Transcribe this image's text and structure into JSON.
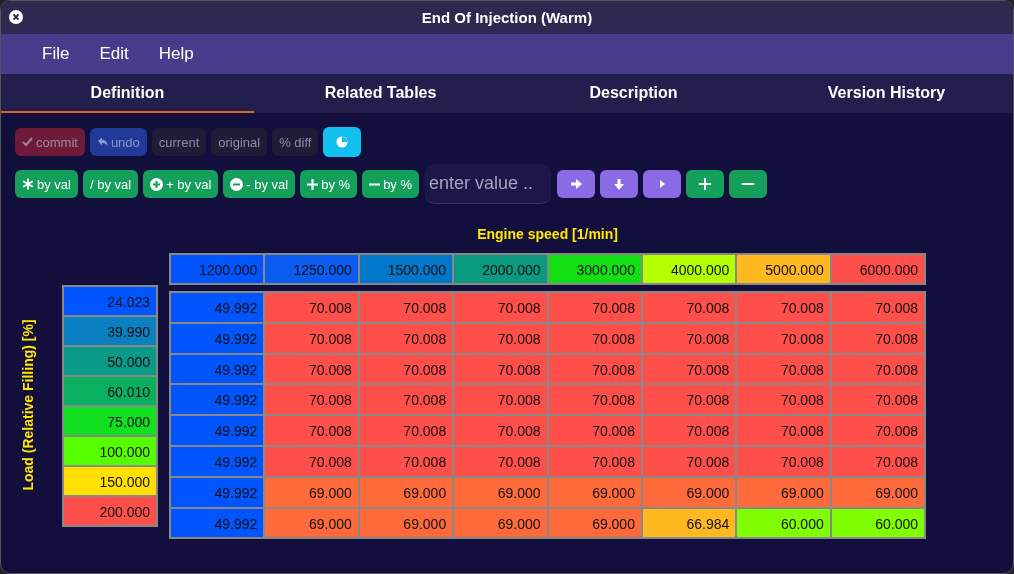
{
  "window": {
    "title": "End Of Injection (Warm)"
  },
  "menu": [
    "File",
    "Edit",
    "Help"
  ],
  "tabs": [
    {
      "label": "Definition",
      "selected": true
    },
    {
      "label": "Related Tables",
      "selected": false
    },
    {
      "label": "Description",
      "selected": false
    },
    {
      "label": "Version History",
      "selected": false
    }
  ],
  "toolbar_1": [
    {
      "kind": "commit",
      "label": "commit"
    },
    {
      "kind": "undo",
      "label": "undo"
    },
    {
      "kind": "view",
      "label": "current"
    },
    {
      "kind": "view",
      "label": "original"
    },
    {
      "kind": "view",
      "label": "% diff"
    },
    {
      "kind": "chart"
    }
  ],
  "toolbar_2": [
    {
      "kind": "multiply",
      "label": "by val"
    },
    {
      "kind": "plain",
      "label": "/ by val"
    },
    {
      "kind": "add",
      "label": "+ by val"
    },
    {
      "kind": "subtract",
      "label": "- by val"
    },
    {
      "kind": "plus",
      "label": "by %"
    },
    {
      "kind": "minus",
      "label": "by %"
    }
  ],
  "value_field": {
    "placeholder": "enter value .."
  },
  "toolbar_3": [
    {
      "kind": "right"
    },
    {
      "kind": "down"
    },
    {
      "kind": "play"
    },
    {
      "kind": "plus"
    },
    {
      "kind": "minus"
    }
  ],
  "table": {
    "x_label": "Engine speed [1/min]",
    "y_label": "Load (Relative Filling) [%]",
    "x_axis": [
      {
        "value": "1200.000",
        "color": "#0055ff"
      },
      {
        "value": "1250.000",
        "color": "#0a5cf0"
      },
      {
        "value": "1500.000",
        "color": "#0077c8"
      },
      {
        "value": "2000.000",
        "color": "#0a9a80"
      },
      {
        "value": "3000.000",
        "color": "#12e012"
      },
      {
        "value": "4000.000",
        "color": "#b4ff00"
      },
      {
        "value": "5000.000",
        "color": "#ffb81f"
      },
      {
        "value": "6000.000",
        "color": "#ff4f4a"
      }
    ],
    "y_axis": [
      {
        "value": "24.023",
        "color": "#0055ff"
      },
      {
        "value": "39.990",
        "color": "#0a80c0"
      },
      {
        "value": "50.000",
        "color": "#0a9a88"
      },
      {
        "value": "60.010",
        "color": "#0ab060"
      },
      {
        "value": "75.000",
        "color": "#10e020"
      },
      {
        "value": "100.000",
        "color": "#55ff00"
      },
      {
        "value": "150.000",
        "color": "#ffe000"
      },
      {
        "value": "200.000",
        "color": "#ff4f4a"
      }
    ],
    "rows": [
      [
        {
          "value": "49.992",
          "color": "#0055ff"
        },
        {
          "value": "70.008",
          "color": "#ff4f4a"
        },
        {
          "value": "70.008",
          "color": "#ff4f4a"
        },
        {
          "value": "70.008",
          "color": "#ff4f4a"
        },
        {
          "value": "70.008",
          "color": "#ff4f4a"
        },
        {
          "value": "70.008",
          "color": "#ff4f4a"
        },
        {
          "value": "70.008",
          "color": "#ff4f4a"
        },
        {
          "value": "70.008",
          "color": "#ff4f4a"
        }
      ],
      [
        {
          "value": "49.992",
          "color": "#0055ff"
        },
        {
          "value": "70.008",
          "color": "#ff4f4a"
        },
        {
          "value": "70.008",
          "color": "#ff4f4a"
        },
        {
          "value": "70.008",
          "color": "#ff4f4a"
        },
        {
          "value": "70.008",
          "color": "#ff4f4a"
        },
        {
          "value": "70.008",
          "color": "#ff4f4a"
        },
        {
          "value": "70.008",
          "color": "#ff4f4a"
        },
        {
          "value": "70.008",
          "color": "#ff4f4a"
        }
      ],
      [
        {
          "value": "49.992",
          "color": "#0055ff"
        },
        {
          "value": "70.008",
          "color": "#ff4f4a"
        },
        {
          "value": "70.008",
          "color": "#ff4f4a"
        },
        {
          "value": "70.008",
          "color": "#ff4f4a"
        },
        {
          "value": "70.008",
          "color": "#ff4f4a"
        },
        {
          "value": "70.008",
          "color": "#ff4f4a"
        },
        {
          "value": "70.008",
          "color": "#ff4f4a"
        },
        {
          "value": "70.008",
          "color": "#ff4f4a"
        }
      ],
      [
        {
          "value": "49.992",
          "color": "#0055ff"
        },
        {
          "value": "70.008",
          "color": "#ff4f4a"
        },
        {
          "value": "70.008",
          "color": "#ff4f4a"
        },
        {
          "value": "70.008",
          "color": "#ff4f4a"
        },
        {
          "value": "70.008",
          "color": "#ff4f4a"
        },
        {
          "value": "70.008",
          "color": "#ff4f4a"
        },
        {
          "value": "70.008",
          "color": "#ff4f4a"
        },
        {
          "value": "70.008",
          "color": "#ff4f4a"
        }
      ],
      [
        {
          "value": "49.992",
          "color": "#0055ff"
        },
        {
          "value": "70.008",
          "color": "#ff4f4a"
        },
        {
          "value": "70.008",
          "color": "#ff4f4a"
        },
        {
          "value": "70.008",
          "color": "#ff4f4a"
        },
        {
          "value": "70.008",
          "color": "#ff4f4a"
        },
        {
          "value": "70.008",
          "color": "#ff4f4a"
        },
        {
          "value": "70.008",
          "color": "#ff4f4a"
        },
        {
          "value": "70.008",
          "color": "#ff4f4a"
        }
      ],
      [
        {
          "value": "49.992",
          "color": "#0055ff"
        },
        {
          "value": "70.008",
          "color": "#ff4f4a"
        },
        {
          "value": "70.008",
          "color": "#ff4f4a"
        },
        {
          "value": "70.008",
          "color": "#ff4f4a"
        },
        {
          "value": "70.008",
          "color": "#ff4f4a"
        },
        {
          "value": "70.008",
          "color": "#ff4f4a"
        },
        {
          "value": "70.008",
          "color": "#ff4f4a"
        },
        {
          "value": "70.008",
          "color": "#ff4f4a"
        }
      ],
      [
        {
          "value": "49.992",
          "color": "#0055ff"
        },
        {
          "value": "69.000",
          "color": "#ff6a3a"
        },
        {
          "value": "69.000",
          "color": "#ff6a3a"
        },
        {
          "value": "69.000",
          "color": "#ff6a3a"
        },
        {
          "value": "69.000",
          "color": "#ff6a3a"
        },
        {
          "value": "69.000",
          "color": "#ff6a3a"
        },
        {
          "value": "69.000",
          "color": "#ff6a3a"
        },
        {
          "value": "69.000",
          "color": "#ff6a3a"
        }
      ],
      [
        {
          "value": "49.992",
          "color": "#0055ff"
        },
        {
          "value": "69.000",
          "color": "#ff6a3a"
        },
        {
          "value": "69.000",
          "color": "#ff6a3a"
        },
        {
          "value": "69.000",
          "color": "#ff6a3a"
        },
        {
          "value": "69.000",
          "color": "#ff6a3a"
        },
        {
          "value": "66.984",
          "color": "#ffb81f"
        },
        {
          "value": "60.000",
          "color": "#80ff00"
        },
        {
          "value": "60.000",
          "color": "#80ff00"
        }
      ]
    ]
  }
}
